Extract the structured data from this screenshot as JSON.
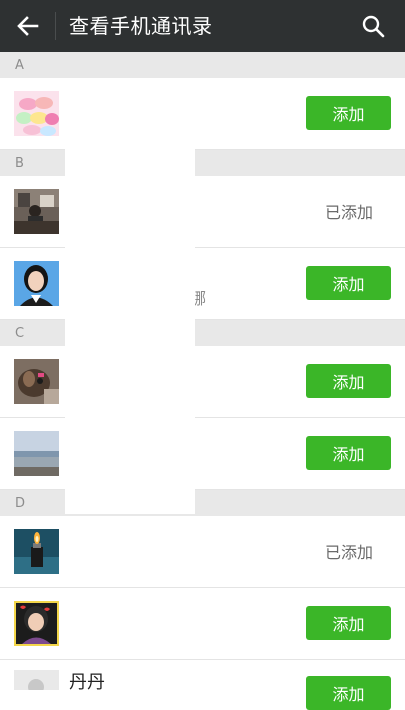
{
  "header": {
    "title": "查看手机通讯录",
    "back_icon": "arrow-left-icon",
    "search_icon": "search-icon",
    "background": "#2e3132"
  },
  "colors": {
    "accent": "#3bb628",
    "section_bg": "#e8e8e8"
  },
  "sections": [
    "A",
    "B",
    "C",
    "D"
  ],
  "contacts": [
    {
      "section": "A",
      "avatar": "macarons-photo-icon",
      "action": "添加"
    },
    {
      "section": "B",
      "avatar": "office-desk-photo-icon",
      "action": "已添加"
    },
    {
      "section": "B",
      "avatar": "woman-portrait-photo-icon",
      "fragment": "娜",
      "action": "添加"
    },
    {
      "section": "C",
      "avatar": "dog-photo-icon",
      "action": "添加"
    },
    {
      "section": "C",
      "avatar": "seaside-photo-icon",
      "action": "添加"
    },
    {
      "section": "D",
      "avatar": "lighter-photo-icon",
      "action": "已添加"
    },
    {
      "section": "D",
      "avatar": "girl-cartoon-photo-icon",
      "action": "添加"
    },
    {
      "section": "D",
      "avatar": "default-avatar-icon",
      "name": "丹丹",
      "action": "添加"
    }
  ]
}
